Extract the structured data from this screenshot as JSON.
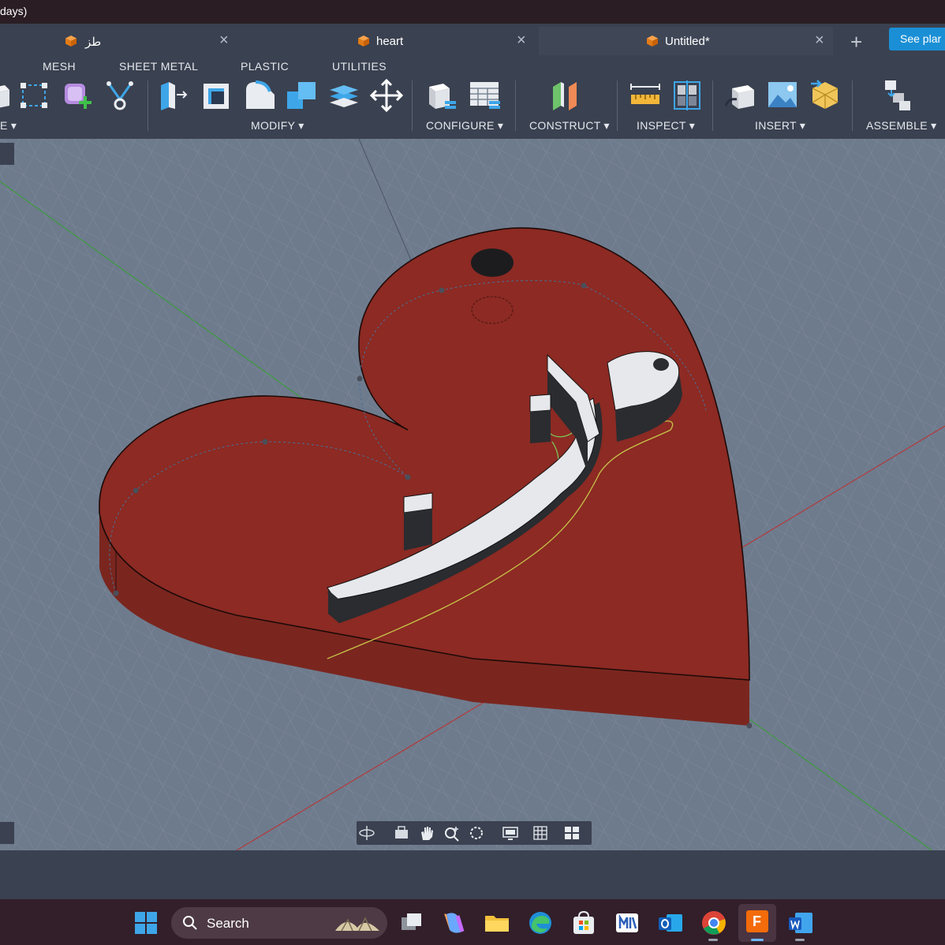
{
  "window": {
    "title_fragment": "days)"
  },
  "tabs": [
    {
      "label": "طز",
      "active": false
    },
    {
      "label": "heart",
      "active": false
    },
    {
      "label": "Untitled*",
      "active": true
    }
  ],
  "new_tab_label": "+",
  "see_plans_label": "See plar",
  "toolbar": {
    "tabs": [
      "MESH",
      "SHEET METAL",
      "PLASTIC",
      "UTILITIES"
    ],
    "groups": {
      "create_fragment": "E",
      "modify": "MODIFY",
      "configure": "CONFIGURE",
      "construct": "CONSTRUCT",
      "inspect": "INSPECT",
      "insert": "INSERT",
      "assemble": "ASSEMBLE"
    },
    "dropdown_marker": "▾"
  },
  "viewport": {
    "background": "#6e7b8d",
    "body_color": "#8c2a23",
    "side_color": "#7a261f",
    "text_extrusion_color": "#e6e8eb",
    "axis_colors": {
      "x": "#b33a3a",
      "y": "#3e9a3e"
    }
  },
  "taskbar": {
    "search_label": "Search",
    "apps": [
      "start-icon",
      "task-view-icon",
      "copilot-icon",
      "file-explorer-icon",
      "edge-icon",
      "store-icon",
      "imdb-icon",
      "outlook-icon",
      "chrome-icon",
      "fusion-icon",
      "word-icon"
    ],
    "fusion_badge": "F"
  }
}
